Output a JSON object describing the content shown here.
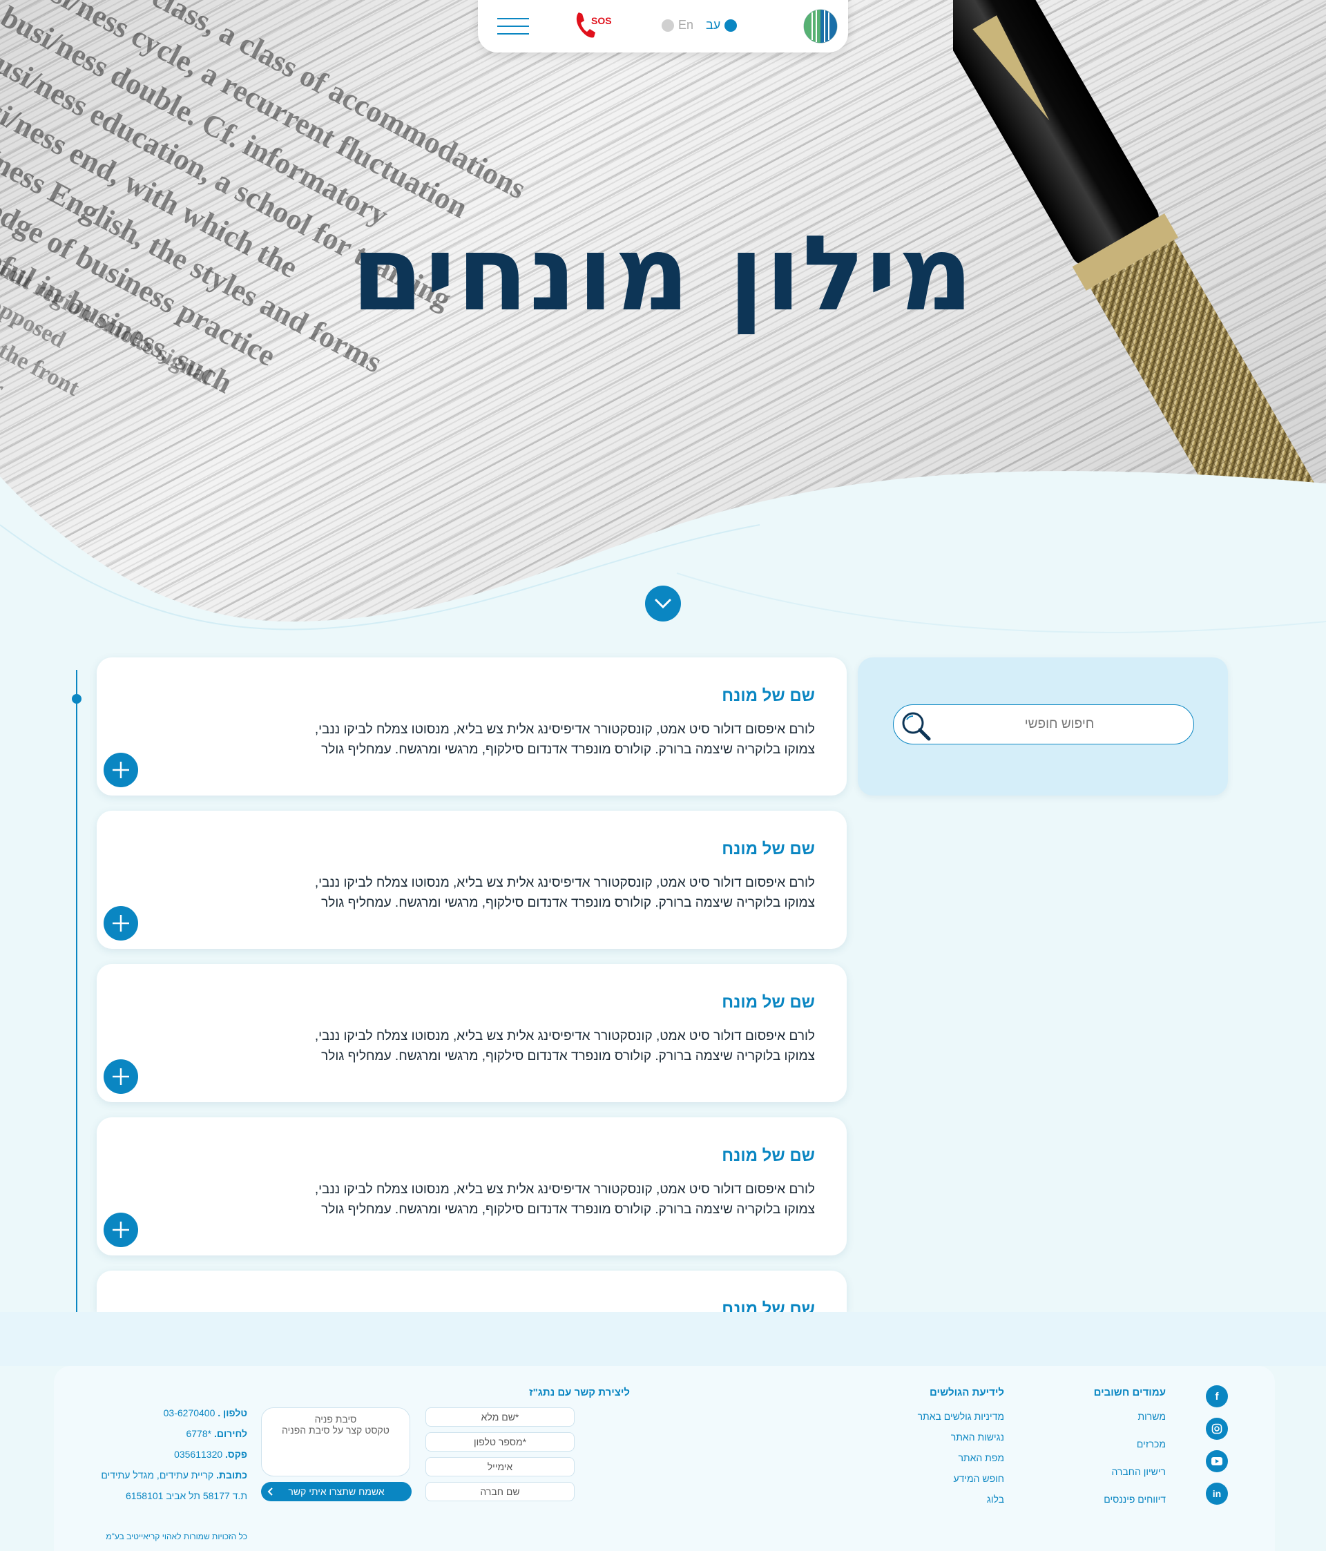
{
  "header": {
    "lang_he": "עב",
    "lang_en": "En",
    "sos_label": "SOS",
    "menu_icon": "hamburger-icon",
    "logo_icon": "globe-logo"
  },
  "hero": {
    "title": "מילון מונחים"
  },
  "search": {
    "placeholder": "חיפוש חופשי"
  },
  "terms": [
    {
      "title": "שם של מונח",
      "text": "לורם איפסום דולור סיט אמט, קונסקטורר אדיפיסינג אלית צש בליא, מנסוטו צמלח לביקו ננבי, צמוקו בלוקריה שיצמה ברורק. קולורס מונפרד אדנדום סילקוף, מרגשי ומרגשח. עמחליף גולר"
    },
    {
      "title": "שם של מונח",
      "text": "לורם איפסום דולור סיט אמט, קונסקטורר אדיפיסינג אלית צש בליא, מנסוטו צמלח לביקו ננבי, צמוקו בלוקריה שיצמה ברורק. קולורס מונפרד אדנדום סילקוף, מרגשי ומרגשח. עמחליף גולר"
    },
    {
      "title": "שם של מונח",
      "text": "לורם איפסום דולור סיט אמט, קונסקטורר אדיפיסינג אלית צש בליא, מנסוטו צמלח לביקו ננבי, צמוקו בלוקריה שיצמה ברורק. קולורס מונפרד אדנדום סילקוף, מרגשי ומרגשח. עמחליף גולר"
    },
    {
      "title": "שם של מונח",
      "text": "לורם איפסום דולור סיט אמט, קונסקטורר אדיפיסינג אלית צש בליא, מנסוטו צמלח לביקו ננבי, צמוקו בלוקריה שיצמה ברורק. קולורס מונפרד אדנדום סילקוף, מרגשי ומרגשח. עמחליף גולר"
    },
    {
      "title": "שם של מונח",
      "text": ""
    }
  ],
  "footer": {
    "important_pages": {
      "heading": "עמודים חשובים",
      "links": [
        "משרות",
        "מכרזים",
        "רישיון החברה",
        "דיווחים פיננסים"
      ]
    },
    "visitors_info": {
      "heading": "לידיעת הגולשים",
      "links": [
        "מדיניות גולשים באתר",
        "נגישות האתר",
        "מפת האתר",
        "חופש המידע",
        "בלוג"
      ]
    },
    "contact_form": {
      "heading": "ליצירת קשר עם נתג\"ז",
      "full_name": "*שם מלא",
      "phone": "*מספר טלפון",
      "email": "אימייל",
      "company": "שם חברה",
      "reason_title": "סיבת פניה",
      "reason_placeholder": "טקסט קצר על סיבת הפניה",
      "submit": "אשמח שתצרו איתי קשר"
    },
    "contact_details": {
      "phone_label": "טלפון .",
      "phone": "03-6270400",
      "emergency_label": "לחירום.",
      "emergency": "*6778",
      "fax_label": "פקס.",
      "fax": "035611320",
      "address_label": "כתובת.",
      "address": "קריית עתידים, מגדל עתידים",
      "pobox": "ת.ד 58177 תל אביב 6158101"
    },
    "copyright": "כל הזכויות שמורות לאהוי קריאייטיב בע\"מ",
    "social": [
      "facebook-icon",
      "instagram-icon",
      "youtube-icon",
      "linkedin-icon"
    ]
  },
  "colors": {
    "accent": "#0a86c2",
    "title": "#0d3556",
    "background": "#eaf6f9",
    "sos": "#e0101b"
  }
}
